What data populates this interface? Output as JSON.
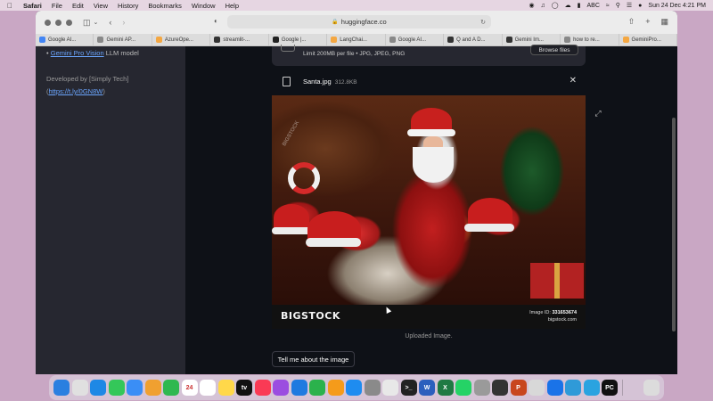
{
  "menubar": {
    "app": "Safari",
    "items": [
      "File",
      "Edit",
      "View",
      "History",
      "Bookmarks",
      "Window",
      "Help"
    ],
    "datetime": "Sun 24 Dec  4:21 PM",
    "input_source": "ABC"
  },
  "browser": {
    "url": "huggingface.co",
    "tabs": [
      {
        "label": "Google AI...",
        "color": "#4285f4"
      },
      {
        "label": "Gemini AP...",
        "color": "#888888"
      },
      {
        "label": "AzureOpe...",
        "color": "#f4a742"
      },
      {
        "label": "streamlit-...",
        "color": "#333333"
      },
      {
        "label": "Google |...",
        "color": "#222222"
      },
      {
        "label": "LangChai...",
        "color": "#f4a742"
      },
      {
        "label": "Google AI...",
        "color": "#888888"
      },
      {
        "label": "Q and A D...",
        "color": "#333333"
      },
      {
        "label": "Gemini Im...",
        "color": "#333333"
      },
      {
        "label": "how to re...",
        "color": "#888888"
      },
      {
        "label": "GeminiPro...",
        "color": "#f4a742"
      }
    ]
  },
  "sidebar": {
    "model_link": "Gemini Pro Vision",
    "model_suffix": "LLM model",
    "developed_by": "Developed by [Simply Tech]",
    "dev_link_prefix": "(",
    "dev_link": "https://t.ly/0GN8W",
    "dev_link_suffix": ")"
  },
  "uploader": {
    "limit_text": "Limit 200MB per file • JPG, JPEG, PNG",
    "browse_label": "Browse files",
    "file_name": "Santa.jpg",
    "file_size": "312.8KB"
  },
  "image": {
    "brand": "BIGSTOCK",
    "image_id_label": "Image ID:",
    "image_id": "331653674",
    "site": "bigstock.com",
    "watermark": "BIGSTOCK"
  },
  "caption": "Uploaded Image.",
  "action_button": "Tell me about the image",
  "dock": {
    "calendar_day": "24",
    "apps": [
      {
        "name": "finder",
        "color": "#2a7fe0",
        "glyph": ""
      },
      {
        "name": "launchpad",
        "color": "#e0e0e0",
        "glyph": ""
      },
      {
        "name": "safari",
        "color": "#1e88e5",
        "glyph": ""
      },
      {
        "name": "messages",
        "color": "#34c759",
        "glyph": ""
      },
      {
        "name": "mail",
        "color": "#3a8ef6",
        "glyph": ""
      },
      {
        "name": "photos",
        "color": "#f0a030",
        "glyph": ""
      },
      {
        "name": "facetime",
        "color": "#2fb84f",
        "glyph": ""
      },
      {
        "name": "calendar",
        "color": "#ffffff",
        "glyph": "24"
      },
      {
        "name": "reminders",
        "color": "#ffffff",
        "glyph": ""
      },
      {
        "name": "notes",
        "color": "#ffd84a",
        "glyph": ""
      },
      {
        "name": "tv",
        "color": "#111111",
        "glyph": "tv"
      },
      {
        "name": "music",
        "color": "#fa3a55",
        "glyph": ""
      },
      {
        "name": "podcasts",
        "color": "#9b4de0",
        "glyph": ""
      },
      {
        "name": "keynote",
        "color": "#1f7ae0",
        "glyph": ""
      },
      {
        "name": "numbers",
        "color": "#2bb24c",
        "glyph": ""
      },
      {
        "name": "pages",
        "color": "#f59b1a",
        "glyph": ""
      },
      {
        "name": "app-store",
        "color": "#1e8cf0",
        "glyph": ""
      },
      {
        "name": "system-settings",
        "color": "#8a8a8a",
        "glyph": ""
      },
      {
        "name": "chrome",
        "color": "#e8e8e8",
        "glyph": ""
      },
      {
        "name": "terminal",
        "color": "#222222",
        "glyph": ">_"
      },
      {
        "name": "word",
        "color": "#2b5fbd",
        "glyph": "W"
      },
      {
        "name": "excel",
        "color": "#1f7a43",
        "glyph": "X"
      },
      {
        "name": "whatsapp",
        "color": "#25d366",
        "glyph": ""
      },
      {
        "name": "automator",
        "color": "#9a9a9a",
        "glyph": ""
      },
      {
        "name": "github-desktop",
        "color": "#333333",
        "glyph": ""
      },
      {
        "name": "powerpoint",
        "color": "#c8461e",
        "glyph": "P"
      },
      {
        "name": "acrobat",
        "color": "#d8d8d8",
        "glyph": ""
      },
      {
        "name": "windows-app",
        "color": "#1a73e8",
        "glyph": ""
      },
      {
        "name": "teams",
        "color": "#2f9ad8",
        "glyph": ""
      },
      {
        "name": "telegram",
        "color": "#2aa3e0",
        "glyph": ""
      },
      {
        "name": "pycharm",
        "color": "#111111",
        "glyph": "PC"
      },
      {
        "name": "trash",
        "color": "#dcdcdc",
        "glyph": ""
      }
    ]
  }
}
